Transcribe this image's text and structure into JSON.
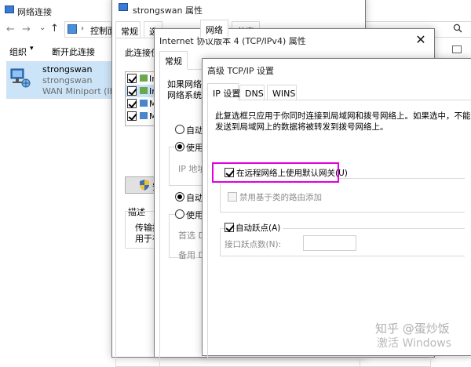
{
  "explorer": {
    "title": "网络连接",
    "address_path": "控制面",
    "search_icon": "search-icon",
    "toolbar": {
      "organize": "组织",
      "disconnect": "断开此连接"
    },
    "connection": {
      "name": "strongswan",
      "line2": "strongswan",
      "line3": "WAN Miniport (IKE"
    }
  },
  "props": {
    "title": "strongswan 属性",
    "tabs": [
      "常规",
      "选",
      "",
      "网络",
      "共享"
    ],
    "section_label": "此连接使",
    "items": [
      "In",
      "In",
      "M",
      "M"
    ],
    "install_button": "安",
    "desc_heading": "描述",
    "desc_lines": [
      "传输控",
      "用于在"
    ]
  },
  "ipv4": {
    "title": "Internet 协议版本 4 (TCP/IPv4) 属性",
    "tab": "常规",
    "intro_lines": [
      "如果网络支",
      "网络系统管"
    ],
    "auto_ip": "自动获",
    "manual_ip": "使用下",
    "ip_label": "IP 地址",
    "auto_dns": "自动获",
    "manual_dns": "使用下",
    "preferred_dns": "首选 DN",
    "alternate_dns": "备用 DN"
  },
  "advanced": {
    "title": "高级 TCP/IP 设置",
    "tabs": [
      "IP 设置",
      "DNS",
      "WINS"
    ],
    "description_lines": [
      "此复选框只应用于你同时连接到局域网和拨号网络上。如果选中，不能",
      "发送到局域网上的数据将被转发到拨号网络上。"
    ],
    "use_default_gateway": "在远程网络上使用默认网关(U)",
    "disable_class_route": "禁用基于类的路由添加",
    "auto_metric": "自动跃点(A)",
    "interface_metric_label": "接口跃点数(N):",
    "interface_metric_value": ""
  },
  "watermark": {
    "line1": "知乎 @蛋炒饭",
    "line2": "激活 Windows"
  },
  "colors": {
    "highlight_box": "#e000e0",
    "selection_bg": "#cce4f7"
  }
}
